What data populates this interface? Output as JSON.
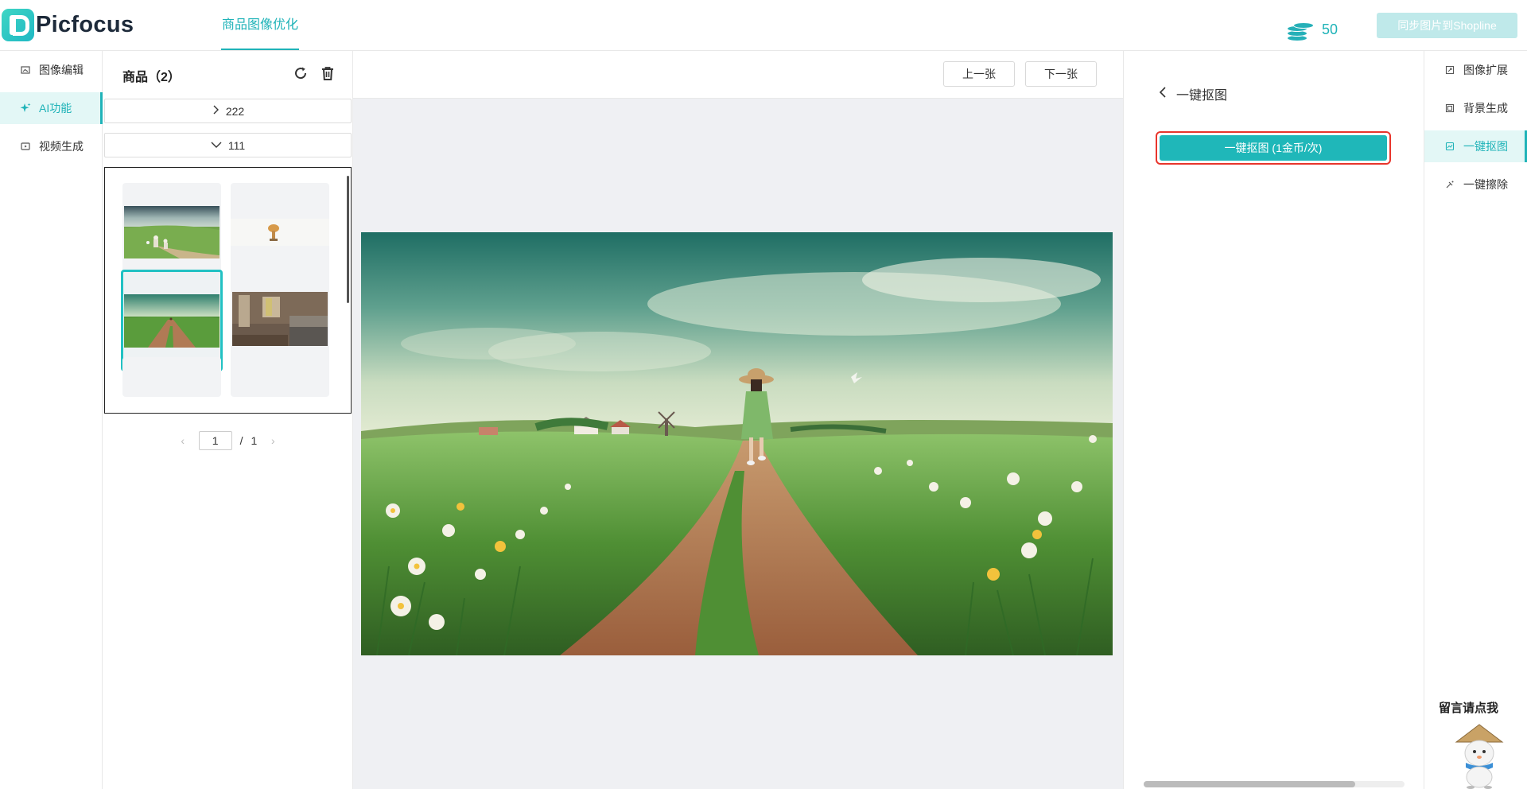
{
  "header": {
    "logo_text": "Picfocus",
    "active_tab": "商品图像优化",
    "coin_count": "50",
    "sync_button": "同步图片到Shopline"
  },
  "left_nav": {
    "items": [
      {
        "label": "图像编辑",
        "icon": "image-edit-icon",
        "active": false
      },
      {
        "label": "AI功能",
        "icon": "sparkle-icon",
        "active": true
      },
      {
        "label": "视频生成",
        "icon": "video-icon",
        "active": false
      }
    ]
  },
  "product_panel": {
    "title": "商品（2）",
    "folders": [
      {
        "label": "222",
        "expanded": false
      },
      {
        "label": "111",
        "expanded": true
      }
    ],
    "pagination": {
      "current": "1",
      "separator": "/",
      "total": "1"
    }
  },
  "center": {
    "prev_button": "上一张",
    "next_button": "下一张"
  },
  "tool_panel": {
    "back_label": "一键抠图",
    "action_button": "一键抠图 (1金币/次)"
  },
  "right_nav": {
    "items": [
      {
        "label": "图像扩展",
        "icon": "expand-icon",
        "active": false
      },
      {
        "label": "背景生成",
        "icon": "background-icon",
        "active": false
      },
      {
        "label": "一键抠图",
        "icon": "cutout-icon",
        "active": true
      },
      {
        "label": "一键擦除",
        "icon": "eraser-icon",
        "active": false
      }
    ],
    "feedback_label": "留言请点我"
  },
  "colors": {
    "accent": "#1fb3b8",
    "highlight_border": "#e8352c",
    "canvas_bg": "#eff0f3"
  }
}
